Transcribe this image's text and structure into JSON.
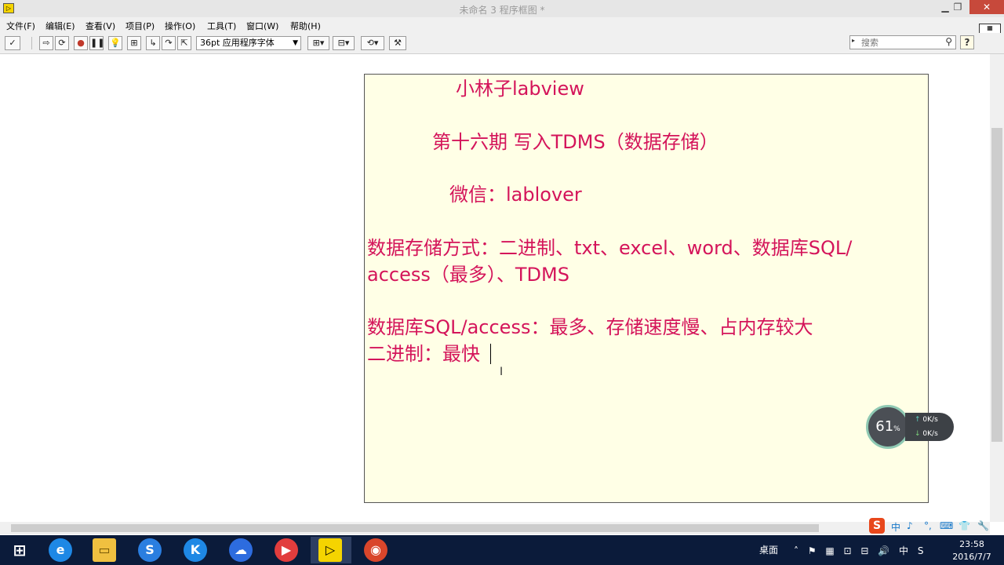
{
  "window": {
    "title": "未命名 3 程序框图 *",
    "app_icon_text": "▷"
  },
  "menu": {
    "items": [
      "文件(F)",
      "编辑(E)",
      "查看(V)",
      "项目(P)",
      "操作(O)",
      "工具(T)",
      "窗口(W)",
      "帮助(H)"
    ]
  },
  "toolbar": {
    "font": "36pt 应用程序字体",
    "search_placeholder": "搜索"
  },
  "note": {
    "lines": [
      "小林子labview",
      "第十六期 写入TDMS（数据存储）",
      "微信：lablover",
      "数据存储方式：二进制、txt、excel、word、数据库SQL/",
      "access（最多）、TDMS",
      "数据库SQL/access：最多、存储速度慢、占内存较大",
      "二进制：最快"
    ],
    "text_color": "#d4145a",
    "background": "#ffffe6"
  },
  "monitor": {
    "percent": "61",
    "percent_unit": "%",
    "upload": "0K/s",
    "download": "0K/s"
  },
  "ime": {
    "items": [
      "中",
      "♪",
      "°,",
      "⌨",
      "👕",
      "🔧"
    ]
  },
  "taskbar": {
    "desktop_label": "桌面",
    "time": "23:58",
    "date": "2016/7/7",
    "tray_ime": "中"
  }
}
